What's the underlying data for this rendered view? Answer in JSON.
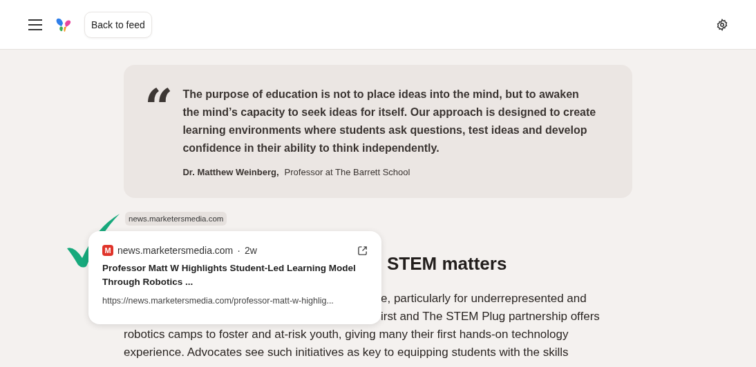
{
  "header": {
    "back_button": "Back to feed"
  },
  "quote": {
    "mark": "“",
    "text": "The purpose of education is not to place ideas into the mind, but to awaken the mind’s capacity to seek ideas for itself. Our approach is designed to create learning environments where students ask questions, test ideas and develop confidence in their ability to think independently.",
    "author": "Dr. Matthew Weinberg,",
    "role": "Professor at The Barrett School"
  },
  "article": {
    "heading": "STEM matters",
    "lines": [
      {
        "text": "e, particularly for underrepresented and",
        "covered": true
      },
      {
        "text": "irst and The STEM Plug partnership offers",
        "covered": true
      },
      {
        "text": "robotics camps to foster and at-risk youth, giving many their first hands-on technology",
        "covered": false
      },
      {
        "text": "experience. Advocates see such initiatives as key to equipping students with the skills",
        "covered": false
      }
    ]
  },
  "citation": {
    "chip": "news.marketersmedia.com",
    "favicon": "M",
    "source": "news.marketersmedia.com",
    "separator": "·",
    "age": "2w",
    "title": "Professor Matt W Highlights Student-Led Learning Model Through Robotics ...",
    "url": "https://news.marketersmedia.com/professor-matt-w-highlig..."
  }
}
